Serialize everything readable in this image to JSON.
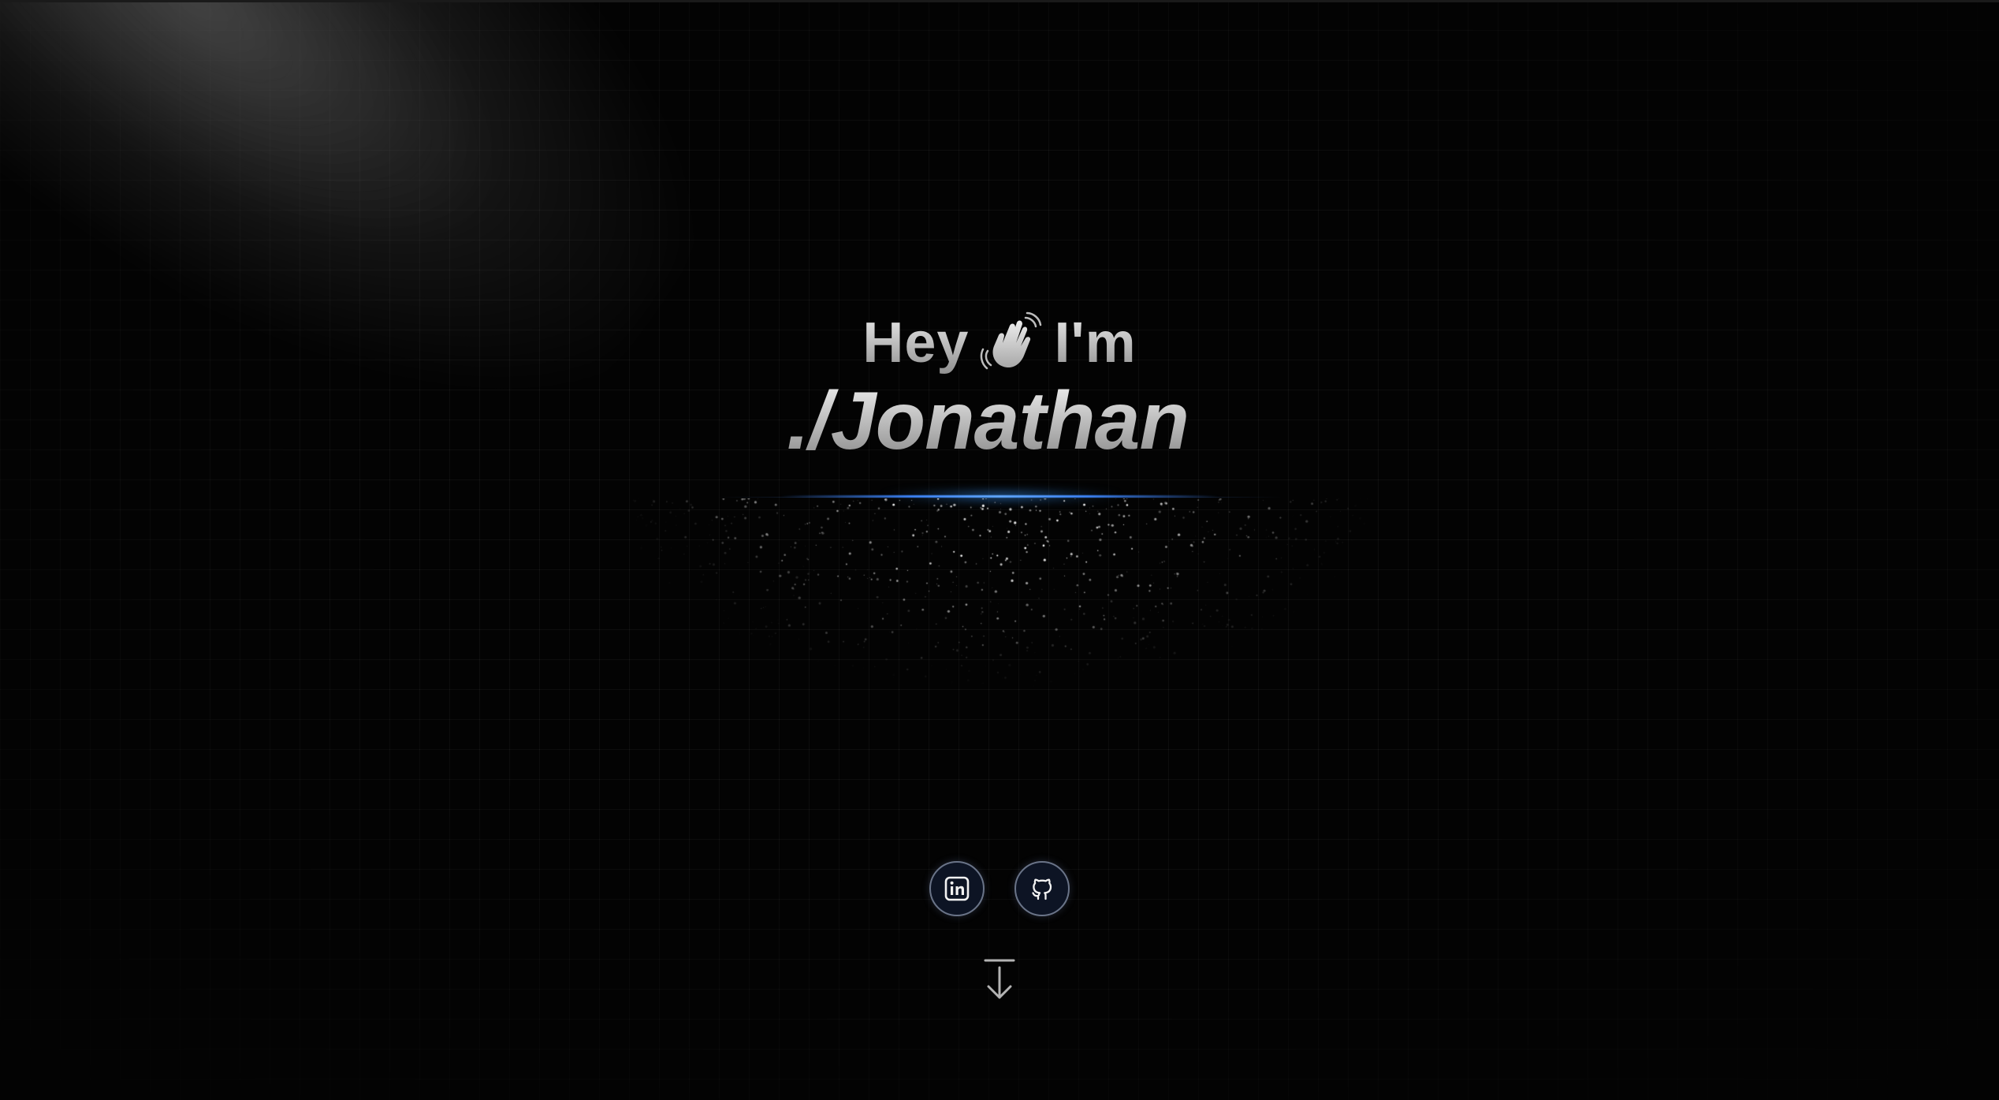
{
  "hero": {
    "greeting_prefix": "Hey",
    "greeting_suffix": "I'm",
    "name": "./Jonathan"
  },
  "social_links": [
    {
      "icon": "linkedin-icon",
      "label": "LinkedIn"
    },
    {
      "icon": "github-icon",
      "label": "GitHub"
    }
  ],
  "scroll_indicator": {
    "icon": "arrow-down-to-line-icon"
  },
  "colors": {
    "background": "#030303",
    "accent_glow": "#3b82f6",
    "text_gradient_top": "#f2f2f2",
    "text_gradient_bottom": "#8a8a8a",
    "social_border": "#6a7488"
  }
}
